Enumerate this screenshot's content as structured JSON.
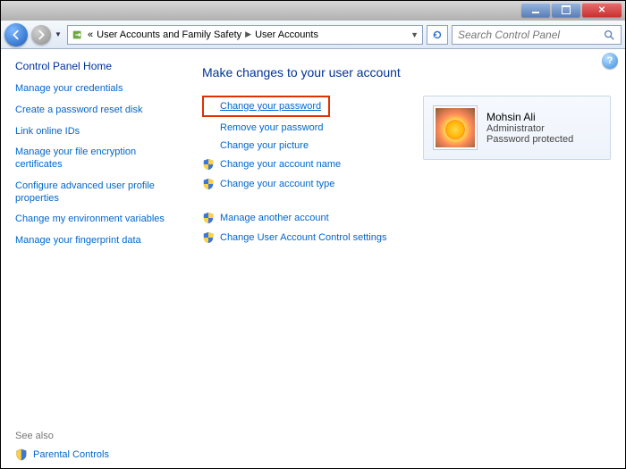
{
  "titlebar": {},
  "nav": {
    "crumb_prefix": "«",
    "crumb1": "User Accounts and Family Safety",
    "crumb2": "User Accounts",
    "search_placeholder": "Search Control Panel"
  },
  "sidebar": {
    "home": "Control Panel Home",
    "links": [
      "Manage your credentials",
      "Create a password reset disk",
      "Link online IDs",
      "Manage your file encryption certificates",
      "Configure advanced user profile properties",
      "Change my environment variables",
      "Manage your fingerprint data"
    ],
    "see_also": "See also",
    "parental": "Parental Controls"
  },
  "content": {
    "title": "Make changes to your user account",
    "actions": {
      "change_pw": "Change your password",
      "remove_pw": "Remove your password",
      "change_pic": "Change your picture",
      "change_name": "Change your account name",
      "change_type": "Change your account type",
      "manage_other": "Manage another account",
      "uac": "Change User Account Control settings"
    },
    "user": {
      "name": "Mohsin Ali",
      "role": "Administrator",
      "prot": "Password protected"
    },
    "help_glyph": "?"
  }
}
